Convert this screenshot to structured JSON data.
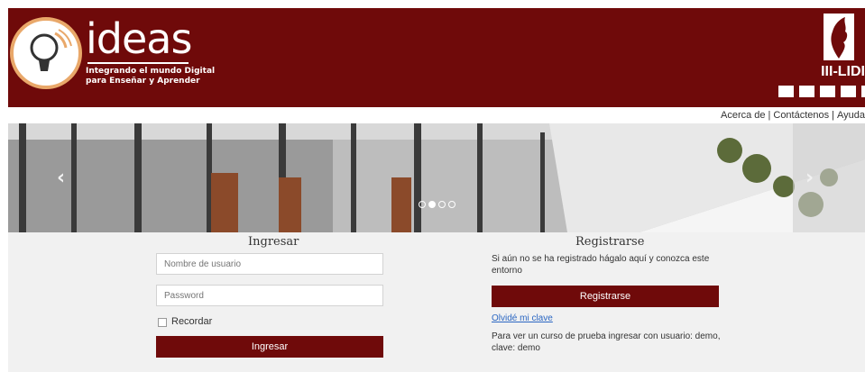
{
  "header": {
    "brand": "ideas",
    "tagline_line1": "Integrando el mundo Digital",
    "tagline_line2": "para Enseñar y Aprender",
    "institution": "III-LIDI"
  },
  "toplinks": {
    "about": "Acerca de",
    "contact": "Contáctenos",
    "help": "Ayuda",
    "separator": "|"
  },
  "banner": {
    "prev_arrow": "‹",
    "next_arrow": "›",
    "slides_count": 4,
    "active_slide": 2
  },
  "login": {
    "title": "Ingresar",
    "username_placeholder": "Nombre de usuario",
    "password_placeholder": "Password",
    "remember_label": "Recordar",
    "submit_label": "Ingresar"
  },
  "register": {
    "title": "Registrarse",
    "description": "Si aún no se ha registrado hágalo aquí y conozca este entorno",
    "button_label": "Registrarse",
    "forgot_link": "Olvidé mi clave",
    "demo_text": "Para ver un curso de prueba ingresar con usuario: demo, clave: demo"
  },
  "colors": {
    "brand": "#6f0a0a",
    "logo_ring": "#e9a86a",
    "link": "#2a66c2"
  }
}
